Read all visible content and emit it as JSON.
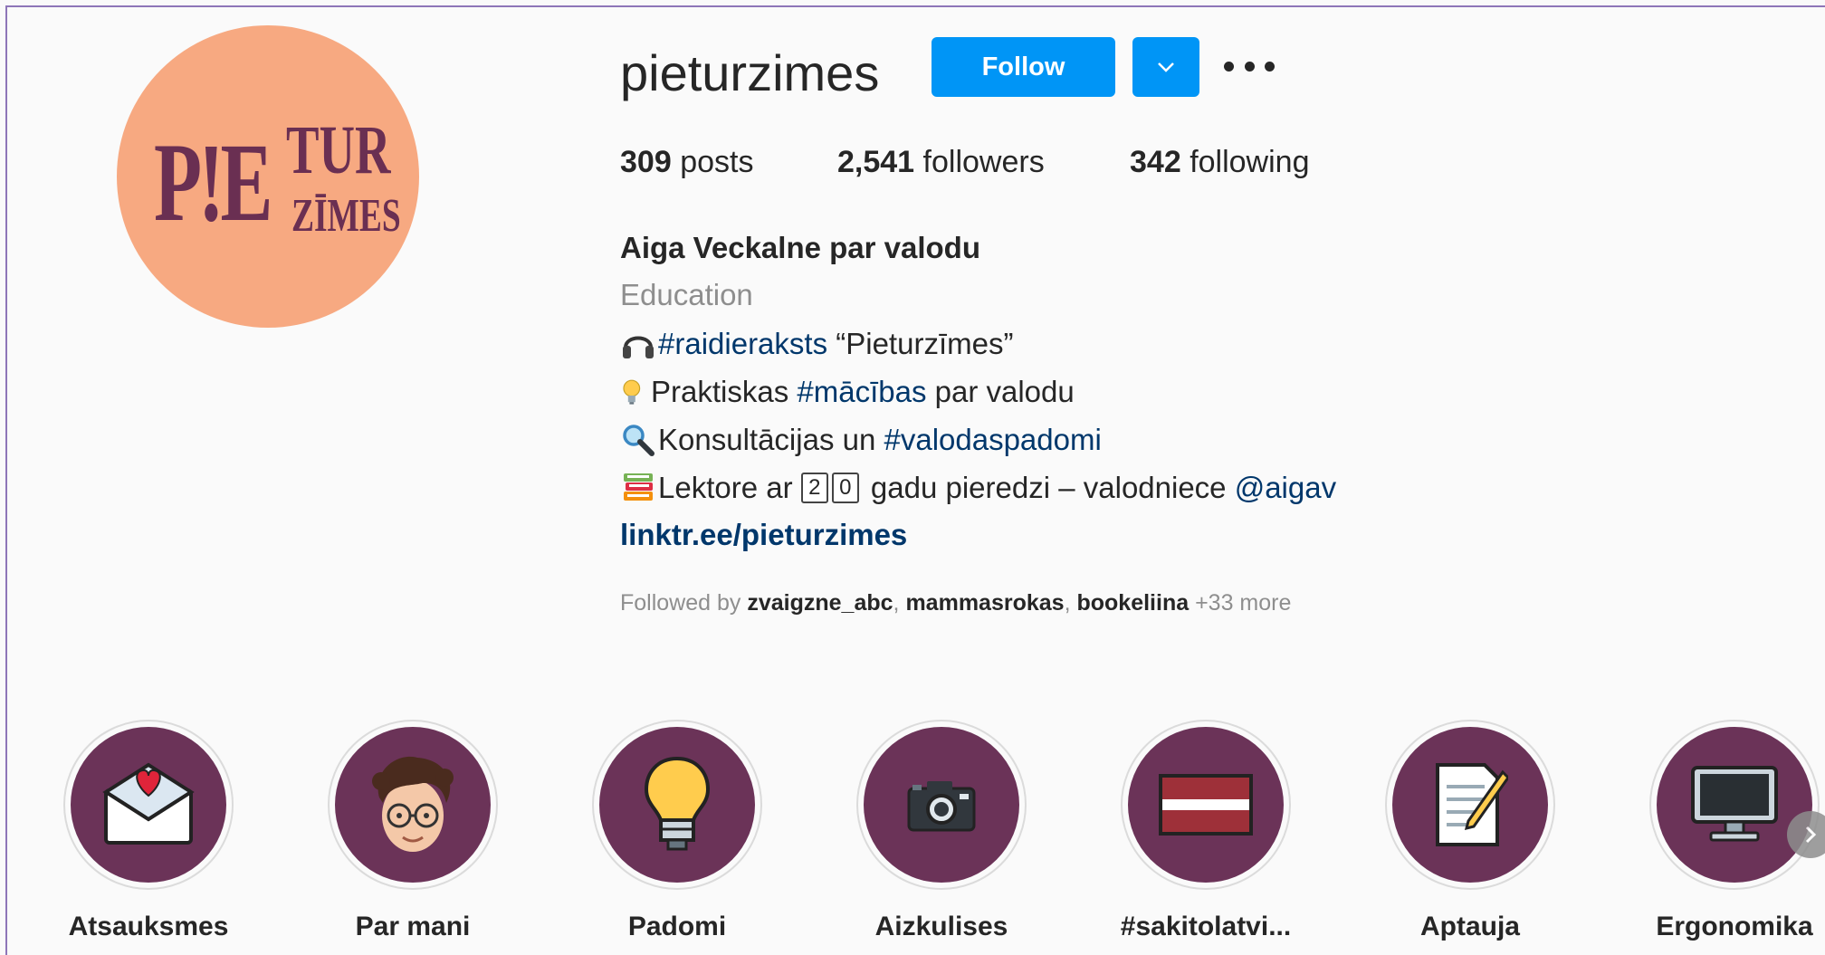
{
  "profile": {
    "username": "pieturzimes",
    "avatar_logo": {
      "line1": "P!E",
      "line2": "TUR",
      "line3": "ZĪMES"
    },
    "follow_label": "Follow",
    "stats": {
      "posts_count": "309",
      "posts_label": "posts",
      "followers_count": "2,541",
      "followers_label": "followers",
      "following_count": "342",
      "following_label": "following"
    },
    "bio": {
      "name": "Aiga Veckalne par valodu",
      "category": "Education",
      "line1": {
        "hashtag": "#raidieraksts",
        "text": " “Pieturzīmes”"
      },
      "line2": {
        "prefix": "Praktiskas ",
        "hashtag": "#mācības",
        "suffix": " par valodu"
      },
      "line3": {
        "prefix": "Konsultācijas un ",
        "hashtag": "#valodaspadomi"
      },
      "line4": {
        "prefix": "Lektore ar ",
        "digit1": "2",
        "digit2": "0",
        "suffix": " gadu pieredzi – valodniece ",
        "mention": "@aigav"
      },
      "link": "linktr.ee/pieturzimes"
    },
    "followed_by": {
      "prefix": "Followed by ",
      "users": [
        "zvaigzne_abc",
        "mammasrokas",
        "bookeliina"
      ],
      "more": "+33 more"
    }
  },
  "highlights": [
    {
      "label": "Atsauksmes",
      "icon": "love-letter-icon"
    },
    {
      "label": "Par mani",
      "icon": "memoji-avatar-icon"
    },
    {
      "label": "Padomi",
      "icon": "light-bulb-icon"
    },
    {
      "label": "Aizkulises",
      "icon": "camera-icon"
    },
    {
      "label": "#sakitolatvi...",
      "icon": "latvian-flag-icon"
    },
    {
      "label": "Aptauja",
      "icon": "memo-icon"
    },
    {
      "label": "Ergonomika",
      "icon": "computer-monitor-icon"
    }
  ],
  "colors": {
    "follow_button": "#0095f6",
    "highlight_bg": "#6b3358",
    "avatar_bg": "#f7a981",
    "link": "#00376b"
  }
}
